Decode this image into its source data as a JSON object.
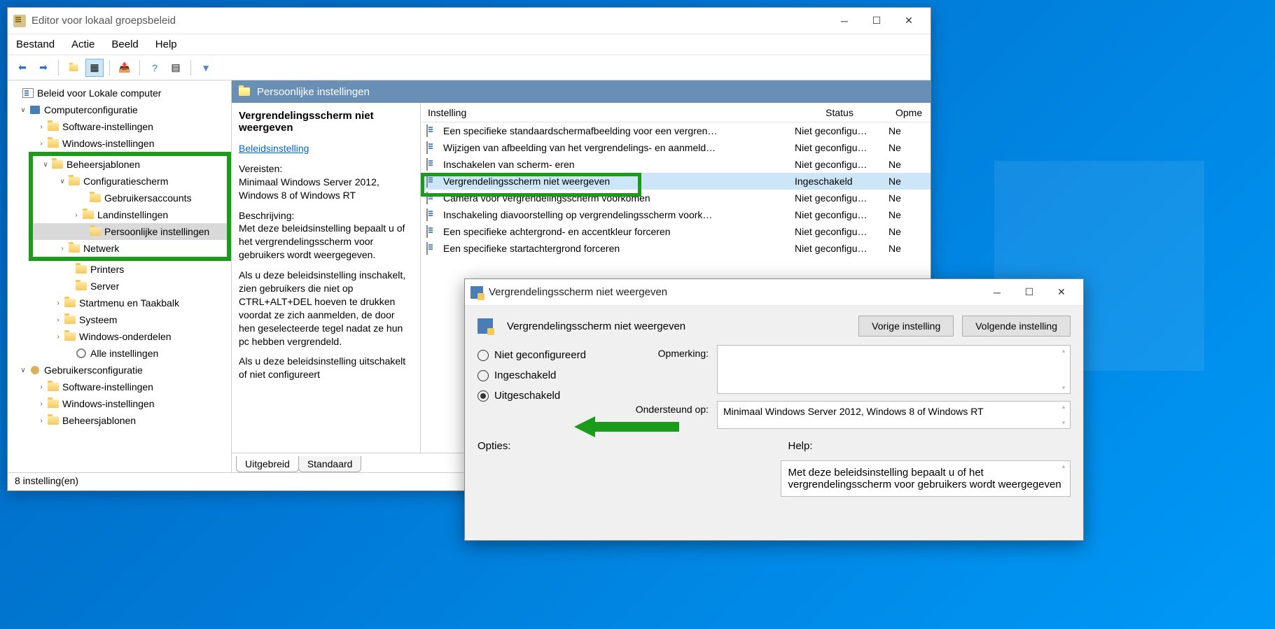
{
  "window": {
    "title": "Editor voor lokaal groepsbeleid",
    "menu": [
      "Bestand",
      "Actie",
      "Beeld",
      "Help"
    ]
  },
  "tree": {
    "root": "Beleid voor Lokale computer",
    "comp": "Computerconfiguratie",
    "sw": "Software-instellingen",
    "win": "Windows-instellingen",
    "bs": "Beheersjablonen",
    "cfg": "Configuratiescherm",
    "ga": "Gebruikersaccounts",
    "land": "Landinstellingen",
    "pers": "Persoonlijke instellingen",
    "net": "Netwerk",
    "prn": "Printers",
    "srv": "Server",
    "start": "Startmenu en Taakbalk",
    "sys": "Systeem",
    "wcmp": "Windows-onderdelen",
    "all": "Alle instellingen",
    "user": "Gebruikersconfiguratie",
    "usw": "Software-instellingen",
    "uwin": "Windows-instellingen",
    "ubs": "Beheersjablonen"
  },
  "header": "Persoonlijke instellingen",
  "desc": {
    "title": "Vergrendelingsscherm niet weergeven",
    "link": "Beleidsinstelling",
    "req_label": "Vereisten:",
    "req_text": "Minimaal Windows Server 2012, Windows 8 of Windows RT",
    "desc_label": "Beschrijving:",
    "desc_text1": "Met deze beleidsinstelling bepaalt u of het vergrendelingsscherm voor gebruikers wordt weergegeven.",
    "desc_text2": "Als u deze beleidsinstelling inschakelt, zien gebruikers die niet op CTRL+ALT+DEL hoeven te drukken voordat ze zich aanmelden, de door hen geselecteerde tegel nadat ze hun pc hebben vergrendeld.",
    "desc_text3": "Als u deze beleidsinstelling uitschakelt of niet configureert"
  },
  "cols": {
    "c1": "Instelling",
    "c2": "Status",
    "c3": "Opme"
  },
  "rows": [
    {
      "t": "Een specifieke standaardschermafbeelding voor een vergren…",
      "s": "Niet geconfigu…",
      "o": "Ne"
    },
    {
      "t": "Wijzigen van afbeelding van het vergrendelings- en aanmeld…",
      "s": "Niet geconfigu…",
      "o": "Ne"
    },
    {
      "t": "Inschakelen van scherm-                                                            eren",
      "s": "Niet geconfigu…",
      "o": "Ne"
    },
    {
      "t": "Vergrendelingsscherm niet weergeven",
      "s": "Ingeschakeld",
      "o": "Ne",
      "sel": true
    },
    {
      "t": "Camera voor vergrendelingsscherm voorkomen",
      "s": "Niet geconfigu…",
      "o": "Ne"
    },
    {
      "t": "Inschakeling diavoorstelling op vergrendelingsscherm voork…",
      "s": "Niet geconfigu…",
      "o": "Ne"
    },
    {
      "t": "Een specifieke achtergrond- en accentkleur forceren",
      "s": "Niet geconfigu…",
      "o": "Ne"
    },
    {
      "t": "Een specifieke startachtergrond forceren",
      "s": "Niet geconfigu…",
      "o": "Ne"
    }
  ],
  "tabs": {
    "t1": "Uitgebreid",
    "t2": "Standaard"
  },
  "status": "8 instelling(en)",
  "dialog": {
    "title": "Vergrendelingsscherm niet weergeven",
    "heading": "Vergrendelingsscherm niet weergeven",
    "prev": "Vorige instelling",
    "next": "Volgende instelling",
    "r1": "Niet geconfigureerd",
    "r2": "Ingeschakeld",
    "r3": "Uitgeschakeld",
    "comment": "Opmerking:",
    "supported": "Ondersteund op:",
    "supported_text": "Minimaal Windows Server 2012, Windows 8 of Windows RT",
    "options": "Opties:",
    "help": "Help:",
    "help_text": "Met deze beleidsinstelling bepaalt u of het vergrendelingsscherm voor gebruikers wordt weergegeven"
  }
}
